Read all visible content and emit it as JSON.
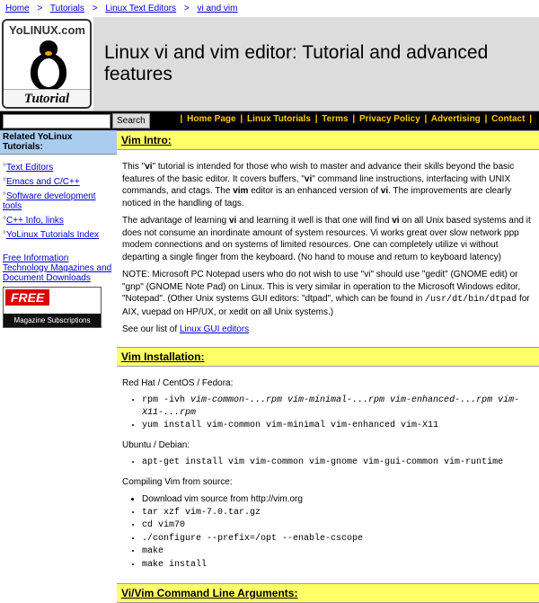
{
  "breadcrumbs": {
    "items": [
      "Home",
      "Tutorials",
      "Linux Text Editors",
      "vi and vim"
    ],
    "sep": ">"
  },
  "logo": {
    "arc": "YoLINUX.com",
    "band": "Tutorial"
  },
  "title": "Linux vi and vim editor: Tutorial and advanced features",
  "search": {
    "button": "Search",
    "value": ""
  },
  "nav": {
    "items": [
      "Home Page",
      "Linux Tutorials",
      "Terms",
      "Privacy Policy",
      "Advertising",
      "Contact"
    ],
    "sep": "|"
  },
  "sidebar": {
    "heading": "Related YoLinux Tutorials:",
    "items": [
      "Text Editors",
      "Emacs and C/C++",
      "Software development tools",
      "C++ Info, links",
      "YoLinux Tutorials Index"
    ],
    "bullet": "°",
    "promo_text": "Free Information Technology Magazines and Document Downloads",
    "promo_free": "FREE",
    "promo_sub": "Magazine\nSubscriptions"
  },
  "sections": {
    "intro": {
      "heading": "Vim Intro:",
      "p1a": "This \"",
      "p1b": "vi",
      "p1c": "\" tutorial is intended for those who wish to master and advance their skills beyond the basic features of the basic editor. It covers buffers, \"",
      "p1d": "vi",
      "p1e": "\" command line instructions, interfacing with UNIX commands, and ctags. The ",
      "p1f": "vim",
      "p1g": " editor is an enhanced version of ",
      "p1h": "vi",
      "p1i": ". The improvements are clearly noticed in the handling of tags.",
      "p2a": "The advantage of learning ",
      "p2b": "vi",
      "p2c": " and learning it well is that one will find ",
      "p2d": "vi",
      "p2e": " on all Unix based systems and it does not consume an inordinate amount of system resources. Vi works great over slow network ppp modem connections and on systems of limited resources. One can completely utilize vi without departing a single finger from the keyboard. (No hand to mouse and return to keyboard latency)",
      "p3a": "NOTE: Microsoft PC Notepad users who do not wish to use \"vi\" should use \"gedit\" (GNOME edit) or \"gnp\" (GNOME Note Pad) on Linux. This is very similar in operation to the Microsoft Windows editor, \"Notepad\". (Other Unix systems GUI editors: \"dtpad\", which can be found in ",
      "p3b": "/usr/dt/bin/dtpad",
      "p3c": " for AIX, vuepad on HP/UX, or xedit on all Unix systems.)",
      "p4a": "See our list of ",
      "p4b": "Linux GUI editors"
    },
    "install": {
      "heading": "Vim Installation:",
      "rh": "Red Hat / CentOS / Fedora:",
      "rh_items": [
        {
          "pre": "rpm -ivh ",
          "i": "vim-common-...rpm vim-minimal-...rpm vim-enhanced-...rpm vim-X11-...rpm"
        },
        {
          "pre": "yum install vim-common vim-minimal vim-enhanced vim-X11",
          "i": ""
        }
      ],
      "deb": "Ubuntu / Debian:",
      "deb_items": [
        {
          "pre": "apt-get install vim vim-common vim-gnome vim-gui-common vim-runtime",
          "i": ""
        }
      ],
      "src": "Compiling Vim from source:",
      "src_items": [
        "Download vim source from http://vim.org",
        "tar xzf vim-7.0.tar.gz",
        "cd vim70",
        "./configure --prefix=/opt --enable-cscope",
        "make",
        "make install"
      ]
    },
    "cli": {
      "heading": "Vi/Vim Command Line Arguments:"
    }
  }
}
